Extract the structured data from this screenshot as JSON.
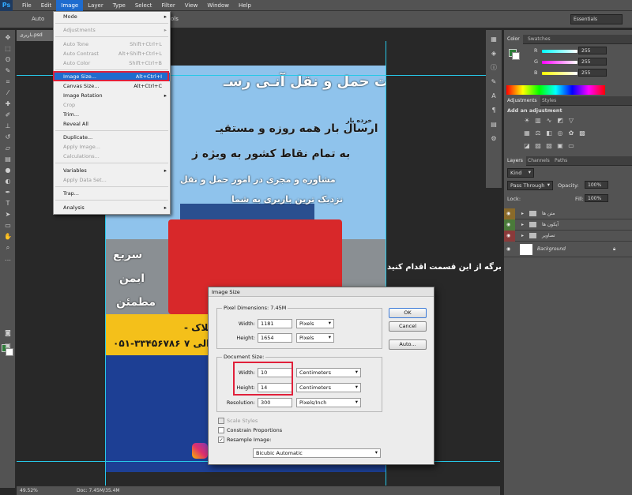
{
  "menubar": {
    "logo": "Ps",
    "items": [
      "File",
      "Edit",
      "Image",
      "Layer",
      "Type",
      "Select",
      "Filter",
      "View",
      "Window",
      "Help"
    ],
    "active_index": 2
  },
  "optbar": {
    "auto": "Auto",
    "controls": "ols",
    "workspace": "Essentials"
  },
  "document": {
    "tab": "باربری.psd",
    "zoom": "49.52%",
    "doc_info": "Doc: 7.45M/35.4M"
  },
  "image_menu": {
    "items": [
      {
        "label": "Mode",
        "shortcut": "",
        "disabled": false,
        "submenu": true
      },
      {
        "label": "Adjustments",
        "shortcut": "",
        "disabled": true,
        "submenu": true
      },
      {
        "label": "Auto Tone",
        "shortcut": "Shift+Ctrl+L",
        "disabled": true,
        "submenu": false
      },
      {
        "label": "Auto Contrast",
        "shortcut": "Alt+Shift+Ctrl+L",
        "disabled": true,
        "submenu": false
      },
      {
        "label": "Auto Color",
        "shortcut": "Shift+Ctrl+B",
        "disabled": true,
        "submenu": false
      },
      {
        "label": "Image Size...",
        "shortcut": "Alt+Ctrl+I",
        "disabled": false,
        "submenu": false
      },
      {
        "label": "Canvas Size...",
        "shortcut": "Alt+Ctrl+C",
        "disabled": false,
        "submenu": false
      },
      {
        "label": "Image Rotation",
        "shortcut": "",
        "disabled": false,
        "submenu": true
      },
      {
        "label": "Crop",
        "shortcut": "",
        "disabled": true,
        "submenu": false
      },
      {
        "label": "Trim...",
        "shortcut": "",
        "disabled": false,
        "submenu": false
      },
      {
        "label": "Reveal All",
        "shortcut": "",
        "disabled": false,
        "submenu": false
      },
      {
        "label": "Duplicate...",
        "shortcut": "",
        "disabled": false,
        "submenu": false
      },
      {
        "label": "Apply Image...",
        "shortcut": "",
        "disabled": true,
        "submenu": false
      },
      {
        "label": "Calculations...",
        "shortcut": "",
        "disabled": true,
        "submenu": false
      },
      {
        "label": "Variables",
        "shortcut": "",
        "disabled": false,
        "submenu": true
      },
      {
        "label": "Apply Data Set...",
        "shortcut": "",
        "disabled": true,
        "submenu": false
      },
      {
        "label": "Trap...",
        "shortcut": "",
        "disabled": false,
        "submenu": false
      },
      {
        "label": "Analysis",
        "shortcut": "",
        "disabled": false,
        "submenu": true
      }
    ]
  },
  "dialog": {
    "title": "Image Size",
    "pixel_dimensions": "Pixel Dimensions: 7.45M",
    "px_width_label": "Width:",
    "px_width": "1181",
    "px_width_unit": "Pixels",
    "px_height_label": "Height:",
    "px_height": "1654",
    "px_height_unit": "Pixels",
    "doc_size": "Document Size:",
    "doc_width_label": "Width:",
    "doc_width": "10",
    "doc_width_unit": "Centimeters",
    "doc_height_label": "Height:",
    "doc_height": "14",
    "doc_height_unit": "Centimeters",
    "resolution_label": "Resolution:",
    "resolution": "300",
    "resolution_unit": "Pixels/Inch",
    "scale_styles": "Scale Styles",
    "constrain": "Constrain Proportions",
    "resample": "Resample Image:",
    "resample_method": "Bicubic Automatic",
    "ok": "OK",
    "cancel": "Cancel",
    "auto": "Auto..."
  },
  "caption": "برای تغییر اندازه برگه از این قسمت اقدام کنید",
  "artwork": {
    "title": "شرکت حمل و نقل آنـی رسـ",
    "sub1": "خرده بار",
    "line1": "ارسال بار همه روزه و مستقیـ",
    "line2": "به تمام نقاط کشور به ویژه ز",
    "line3": "مشاوره و مجری در امور حمل و نقل",
    "line4": "نزدیک ترین باربری به شما",
    "feat1": "سریع",
    "feat2": "ایمن",
    "feat3": "مطمئن",
    "phone": "۰۵۱-۳۳۴۵۶۷۸۶",
    "plak": "- پلاک",
    "al": "۷ الی"
  },
  "color_panel": {
    "tabs": [
      "Color",
      "Swatches"
    ],
    "r": "255",
    "g": "255",
    "b": "255",
    "r_label": "R",
    "g_label": "G",
    "b_label": "B"
  },
  "adjust_panel": {
    "tabs": [
      "Adjustments",
      "Styles"
    ],
    "heading": "Add an adjustment"
  },
  "layers_panel": {
    "tabs": [
      "Layers",
      "Channels",
      "Paths"
    ],
    "kind": "Kind",
    "blend": "Pass Through",
    "opacity_label": "Opacity:",
    "opacity": "100%",
    "lock_label": "Lock:",
    "fill_label": "Fill:",
    "fill": "100%",
    "layers": [
      {
        "name": "متن ها",
        "color": "#8a6a2a"
      },
      {
        "name": "آیکون ها",
        "color": "#4a7a3a"
      },
      {
        "name": "تصاویر",
        "color": "#8a3a3a"
      },
      {
        "name": "Background",
        "color": ""
      }
    ]
  }
}
